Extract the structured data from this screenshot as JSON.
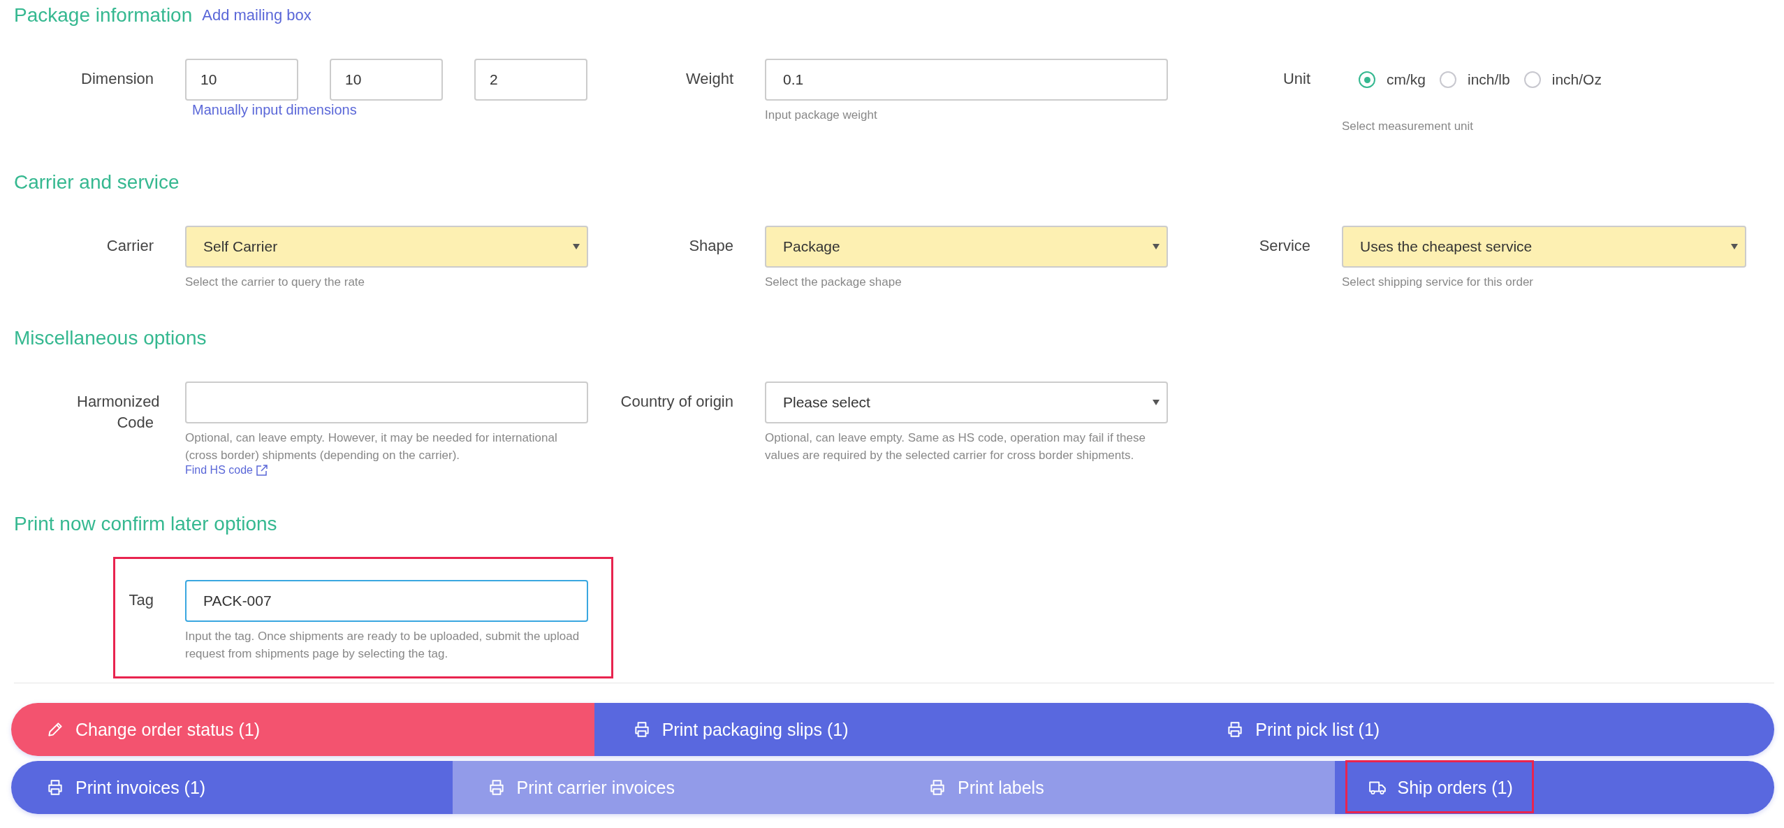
{
  "sections": [
    {
      "title": "Package information",
      "link": "Add mailing box",
      "rows": [
        [
          {
            "kind": "dimensions",
            "label": "Dimension",
            "values": [
              "10",
              "10",
              "2"
            ],
            "link": "Manually input dimensions"
          },
          {
            "kind": "input",
            "label": "Weight",
            "value": "0.1",
            "hint": "Input package weight"
          },
          {
            "kind": "radio",
            "label": "Unit",
            "options": [
              {
                "label": "cm/kg",
                "selected": true
              },
              {
                "label": "inch/lb",
                "selected": false
              },
              {
                "label": "inch/Oz",
                "selected": false
              }
            ],
            "hint": "Select measurement unit"
          }
        ]
      ]
    },
    {
      "title": "Carrier and service",
      "rows": [
        [
          {
            "kind": "select",
            "label": "Carrier",
            "value": "Self Carrier",
            "autofilled": true,
            "hint": "Select the carrier to query the rate"
          },
          {
            "kind": "select",
            "label": "Shape",
            "value": "Package",
            "autofilled": true,
            "hint": "Select the package shape"
          },
          {
            "kind": "select",
            "label": "Service",
            "value": "Uses the cheapest service",
            "autofilled": true,
            "hint": "Select shipping service for this order"
          }
        ]
      ]
    },
    {
      "title": "Miscellaneous options",
      "rows": [
        [
          {
            "kind": "input",
            "label": "Harmonized Code",
            "hint": "Optional, can leave empty. However, it may be needed for international (cross border) shipments (depending on the carrier).",
            "link": "Find HS code"
          },
          {
            "kind": "select",
            "label": "Country of origin",
            "value": "Please select",
            "autofilled": false,
            "hint": "Optional, can leave empty. Same as HS code, operation may fail if these values are required by the selected carrier for cross border shipments."
          }
        ]
      ]
    },
    {
      "title": "Print now confirm later options",
      "rows": [
        [
          {
            "kind": "input",
            "label": "Tag",
            "value": "PACK-007",
            "focused": true,
            "highlighted": true,
            "hint": "Input the tag. Once shipments are ready to be uploaded, submit the upload request from shipments page by selecting the tag."
          }
        ]
      ]
    }
  ],
  "action_rows": [
    [
      {
        "label": "Change order status (1)",
        "kind": "danger",
        "highlighted": false
      },
      {
        "label": "Print packaging slips (1)",
        "kind": "primary",
        "highlighted": false
      },
      {
        "label": "Print pick list (1)",
        "kind": "primary",
        "highlighted": false
      }
    ],
    [
      {
        "label": "Print invoices (1)",
        "kind": "primary",
        "highlighted": false
      },
      {
        "label": "Print carrier invoices",
        "kind": "muted",
        "highlighted": false
      },
      {
        "label": "Print labels",
        "kind": "muted",
        "highlighted": false
      },
      {
        "label": "Ship orders (1)",
        "kind": "primary",
        "highlighted": true
      }
    ]
  ]
}
